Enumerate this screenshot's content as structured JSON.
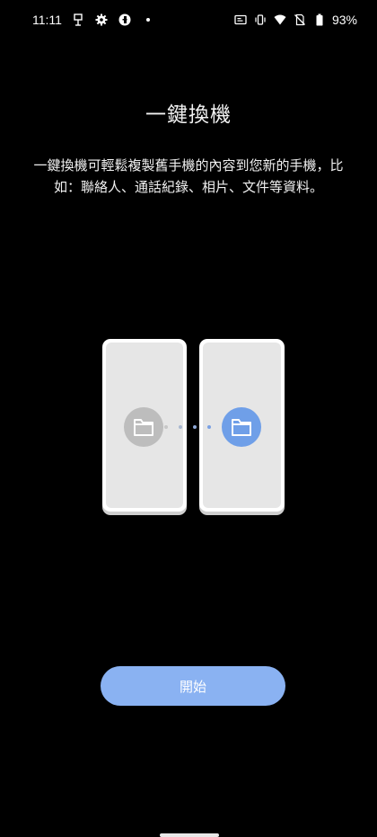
{
  "status_bar": {
    "time": "11:11",
    "battery_percent": "93%",
    "left_icons": [
      "cast-icon",
      "gear-icon",
      "app-icon",
      "dot-icon"
    ],
    "right_icons": [
      "nfc-icon",
      "vibrate-icon",
      "wifi-icon",
      "no-sim-icon",
      "battery-icon"
    ]
  },
  "page": {
    "title": "一鍵換機",
    "description": "一鍵換機可輕鬆複製舊手機的內容到您新的手機，比如：聯絡人、通話紀錄、相片、文件等資料。"
  },
  "illustration": {
    "left_folder_color": "#bdbdbd",
    "right_folder_color": "#6f9fe8",
    "phone_color": "#e6e6e6"
  },
  "actions": {
    "start_label": "開始"
  },
  "colors": {
    "background": "#000000",
    "accent": "#8ab2f2"
  }
}
